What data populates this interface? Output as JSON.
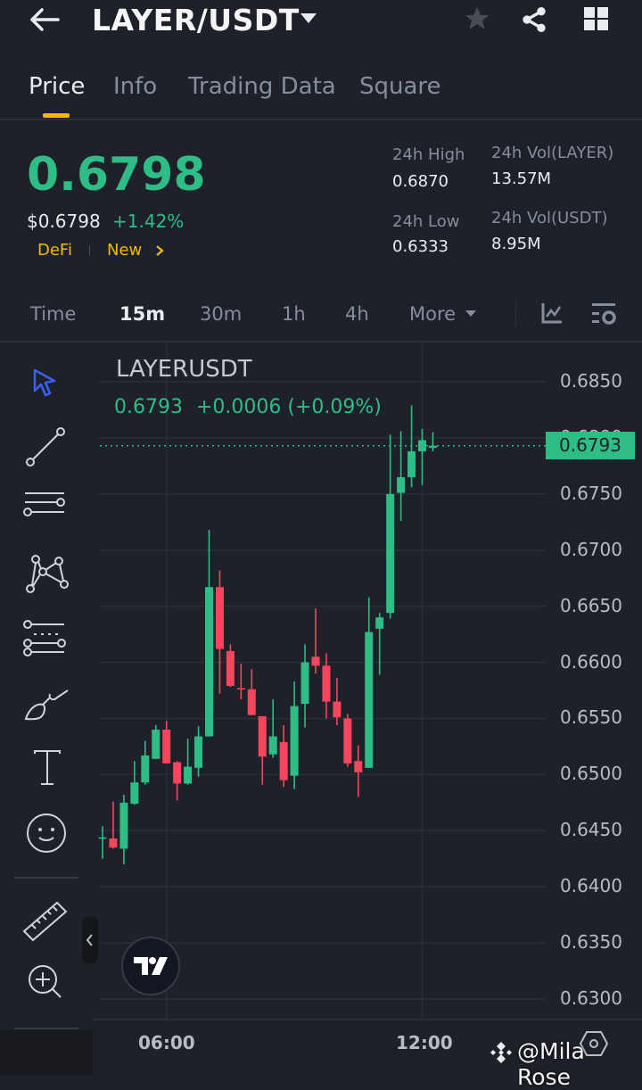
{
  "header": {
    "title": "LAYER/USDT"
  },
  "tabs": [
    {
      "label": "Price"
    },
    {
      "label": "Info"
    },
    {
      "label": "Trading Data"
    },
    {
      "label": "Square"
    }
  ],
  "ticker": {
    "last_price": "0.6798",
    "usd_price": "$0.6798",
    "change_pct": "+1.42%",
    "tags": [
      "DeFi",
      "New"
    ],
    "stats": {
      "high_label": "24h High",
      "high": "0.6870",
      "low_label": "24h Low",
      "low": "0.6333",
      "vol_base_label": "24h Vol(LAYER)",
      "vol_base": "13.57M",
      "vol_quote_label": "24h Vol(USDT)",
      "vol_quote": "8.95M"
    }
  },
  "timeframes": [
    {
      "label": "Time"
    },
    {
      "label": "15m"
    },
    {
      "label": "30m"
    },
    {
      "label": "1h"
    },
    {
      "label": "4h"
    },
    {
      "label": "More"
    }
  ],
  "legend": {
    "symbol": "LAYERUSDT",
    "price": "0.6793",
    "change": "+0.0006 (+0.09%)"
  },
  "current_price_label": "0.6793",
  "watermark": "@Mila Rose",
  "colors": {
    "up": "#2ebd85",
    "down": "#f6465d",
    "accent": "#f0b90b",
    "tool_active": "#3861fb"
  },
  "chart_data": {
    "type": "candlestick",
    "interval": "15m",
    "symbol": "LAYERUSDT",
    "ylim": [
      0.63,
      0.685
    ],
    "y_ticks": [
      "0.6850",
      "0.6800",
      "0.6750",
      "0.6700",
      "0.6650",
      "0.6600",
      "0.6550",
      "0.6500",
      "0.6450",
      "0.6400",
      "0.6350",
      "0.6300"
    ],
    "x_ticks": [
      {
        "label": "06:00",
        "index": 6
      },
      {
        "label": "12:00",
        "index": 30
      }
    ],
    "candles": [
      [
        0.6443,
        0.6454,
        0.6425,
        0.6444
      ],
      [
        0.6443,
        0.6476,
        0.6434,
        0.6435
      ],
      [
        0.6434,
        0.6482,
        0.642,
        0.6475
      ],
      [
        0.6474,
        0.6512,
        0.6473,
        0.6493
      ],
      [
        0.6493,
        0.653,
        0.6491,
        0.6517
      ],
      [
        0.6514,
        0.6544,
        0.6514,
        0.654
      ],
      [
        0.654,
        0.6548,
        0.651,
        0.651
      ],
      [
        0.6511,
        0.6512,
        0.6477,
        0.6492
      ],
      [
        0.6492,
        0.6532,
        0.6491,
        0.6507
      ],
      [
        0.6506,
        0.6543,
        0.6498,
        0.6534
      ],
      [
        0.6534,
        0.6718,
        0.6534,
        0.6667
      ],
      [
        0.6667,
        0.6682,
        0.6572,
        0.6612
      ],
      [
        0.661,
        0.6616,
        0.6578,
        0.6579
      ],
      [
        0.6577,
        0.6599,
        0.6567,
        0.6576
      ],
      [
        0.6576,
        0.6594,
        0.6553,
        0.6553
      ],
      [
        0.6552,
        0.6552,
        0.6491,
        0.6516
      ],
      [
        0.6518,
        0.6567,
        0.6515,
        0.6534
      ],
      [
        0.6529,
        0.6544,
        0.6489,
        0.6495
      ],
      [
        0.6499,
        0.6583,
        0.6487,
        0.6561
      ],
      [
        0.6563,
        0.6616,
        0.6542,
        0.66
      ],
      [
        0.6605,
        0.6648,
        0.659,
        0.6597
      ],
      [
        0.6597,
        0.6608,
        0.655,
        0.6565
      ],
      [
        0.6565,
        0.6586,
        0.6544,
        0.6551
      ],
      [
        0.655,
        0.6554,
        0.6507,
        0.651
      ],
      [
        0.6512,
        0.6526,
        0.648,
        0.6502
      ],
      [
        0.6506,
        0.6658,
        0.6506,
        0.6627
      ],
      [
        0.663,
        0.6644,
        0.6589,
        0.664
      ],
      [
        0.6644,
        0.6803,
        0.6639,
        0.675
      ],
      [
        0.6751,
        0.6806,
        0.6726,
        0.6765
      ],
      [
        0.6765,
        0.6829,
        0.6756,
        0.6788
      ],
      [
        0.6788,
        0.6808,
        0.6758,
        0.6798
      ],
      [
        0.6791,
        0.6805,
        0.6788,
        0.6793
      ]
    ],
    "candle_format": [
      "open",
      "high",
      "low",
      "close"
    ],
    "last_price": 0.6793
  }
}
